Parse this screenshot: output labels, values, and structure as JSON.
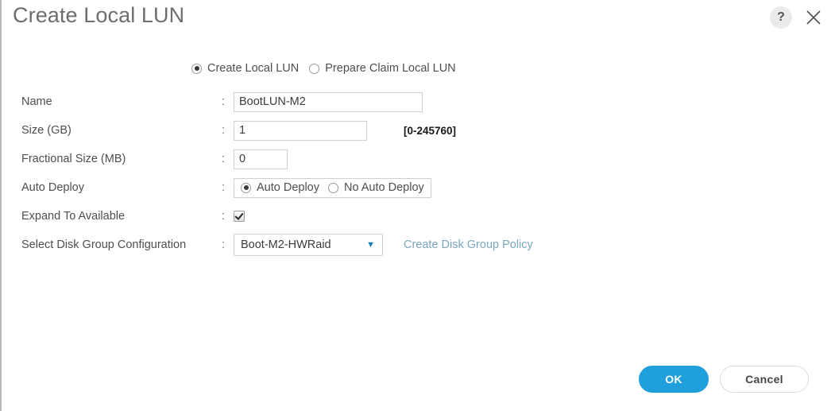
{
  "dialog": {
    "title": "Create Local LUN",
    "help_icon": "question-mark-icon",
    "close_icon": "close-icon"
  },
  "mode": {
    "options": [
      {
        "label": "Create Local LUN",
        "selected": true
      },
      {
        "label": "Prepare Claim Local LUN",
        "selected": false
      }
    ]
  },
  "form": {
    "colon": ":",
    "rows": [
      {
        "label": "Name",
        "value": "BootLUN-M2"
      },
      {
        "label": "Size (GB)",
        "value": "1",
        "hint": "[0-245760]"
      },
      {
        "label": "Fractional Size (MB)",
        "value": "0"
      },
      {
        "label": "Auto Deploy"
      },
      {
        "label": "Expand To Available"
      },
      {
        "label": "Select Disk Group Configuration"
      }
    ],
    "auto_deploy": {
      "options": [
        {
          "label": "Auto Deploy",
          "selected": true
        },
        {
          "label": "No Auto Deploy",
          "selected": false
        }
      ]
    },
    "expand_to_available": {
      "checked": true
    },
    "disk_group": {
      "selected": "Boot-M2-HWRaid",
      "caret": "▼",
      "link": "Create Disk Group Policy"
    }
  },
  "footer": {
    "ok_label": "OK",
    "cancel_label": "Cancel"
  },
  "colors": {
    "accent": "#1fa0dc",
    "link": "#7ba7bd",
    "text": "#4e4e52",
    "border": "#d0d0d4"
  }
}
